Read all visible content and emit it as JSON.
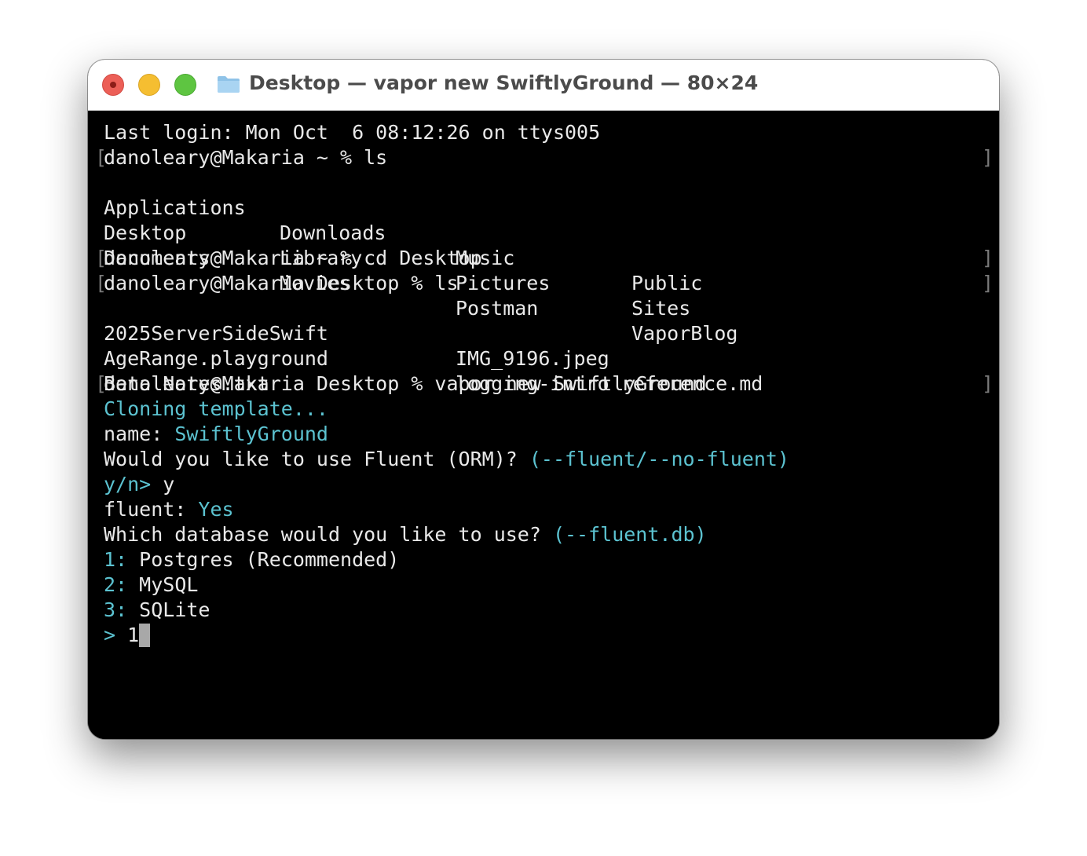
{
  "window": {
    "title": "Desktop — vapor new SwiftlyGround — 80×24",
    "colors": {
      "close": "#ec5f57",
      "minimize": "#f5be31",
      "maximize": "#5ec541",
      "accent_cyan": "#5cc3d1",
      "terminal_bg": "#000000",
      "terminal_fg": "#e9e9e9"
    },
    "icon": "folder-icon"
  },
  "terminal": {
    "last_login": "Last login: Mon Oct  6 08:12:26 on ttys005",
    "cmd1": "danoleary@Makaria ~ % ls",
    "ls_home": [
      [
        "Applications",
        "Downloads",
        "Music",
        "Public"
      ],
      [
        "Desktop",
        "Library",
        "Pictures",
        "Sites"
      ],
      [
        "Documents",
        "Movies",
        "Postman",
        "VaporBlog"
      ]
    ],
    "cmd2": "danoleary@Makaria ~ % cd Desktop",
    "cmd3": "danoleary@Makaria Desktop % ls",
    "ls_desktop": [
      [
        "2025ServerSideSwift",
        "IMG_9196.jpeg"
      ],
      [
        "AgeRange.playground",
        "logging-intro reference.md"
      ],
      [
        "Beta Notes.txt",
        ""
      ]
    ],
    "cmd4": "danoleary@Makaria Desktop % vapor new SwiftlyGround",
    "cloning": "Cloning template...",
    "name_label": "name: ",
    "name_value": "SwiftlyGround",
    "fluent_question": "Would you like to use Fluent (ORM)? ",
    "fluent_flag": "(--fluent/--no-fluent)",
    "yn_prompt": "y/n>",
    "yn_answer": " y",
    "fluent_label": "fluent: ",
    "fluent_value": "Yes",
    "db_question": "Which database would you like to use? ",
    "db_flag": "(--fluent.db)",
    "options": [
      {
        "num": "1:",
        "label": " Postgres (Recommended)"
      },
      {
        "num": "2:",
        "label": " MySQL"
      },
      {
        "num": "3:",
        "label": " SQLite"
      }
    ],
    "input_prompt": ">",
    "input_value": " 1",
    "bracket_open": "[",
    "bracket_close": "]"
  }
}
